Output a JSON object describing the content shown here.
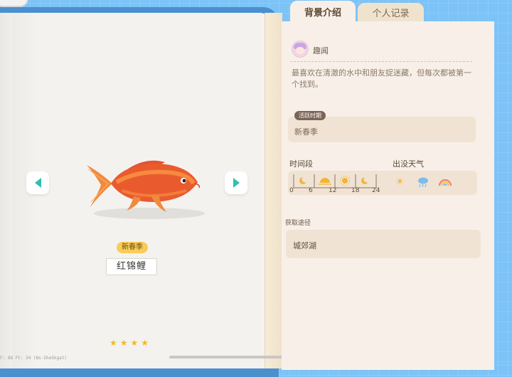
{
  "tabs": {
    "background": "背景介绍",
    "record": "个人记录"
  },
  "fish": {
    "season_tag": "新春季",
    "name": "红锦鲤",
    "rarity_stars": 4
  },
  "intro": {
    "title": "趣闻",
    "description": "最喜欢在清澈的水中和朋友捉迷藏，但每次都被第一个找到。"
  },
  "active_period": {
    "tag": "活跃时期",
    "value": "新春季"
  },
  "time": {
    "label": "时间段",
    "ticks": [
      "0",
      "6",
      "12",
      "18",
      "24"
    ],
    "segments": [
      "moon-icon",
      "sunrise-icon",
      "sun-icon",
      "moon-icon"
    ]
  },
  "weather": {
    "label": "出没天气",
    "icons": [
      "sunny-icon",
      "rain-icon",
      "rainbow-icon"
    ]
  },
  "source": {
    "label": "获取途径",
    "value": "城郊湖"
  },
  "debug": {
    "text": "F: 88    Ft: 34    (Bs-SheSkgat)"
  },
  "colors": {
    "accent": "#2fbfb1",
    "tag_yellow": "#f9cc58",
    "star": "#f3b829",
    "page": "#f8f0e8",
    "cover": "#4a90cf"
  }
}
